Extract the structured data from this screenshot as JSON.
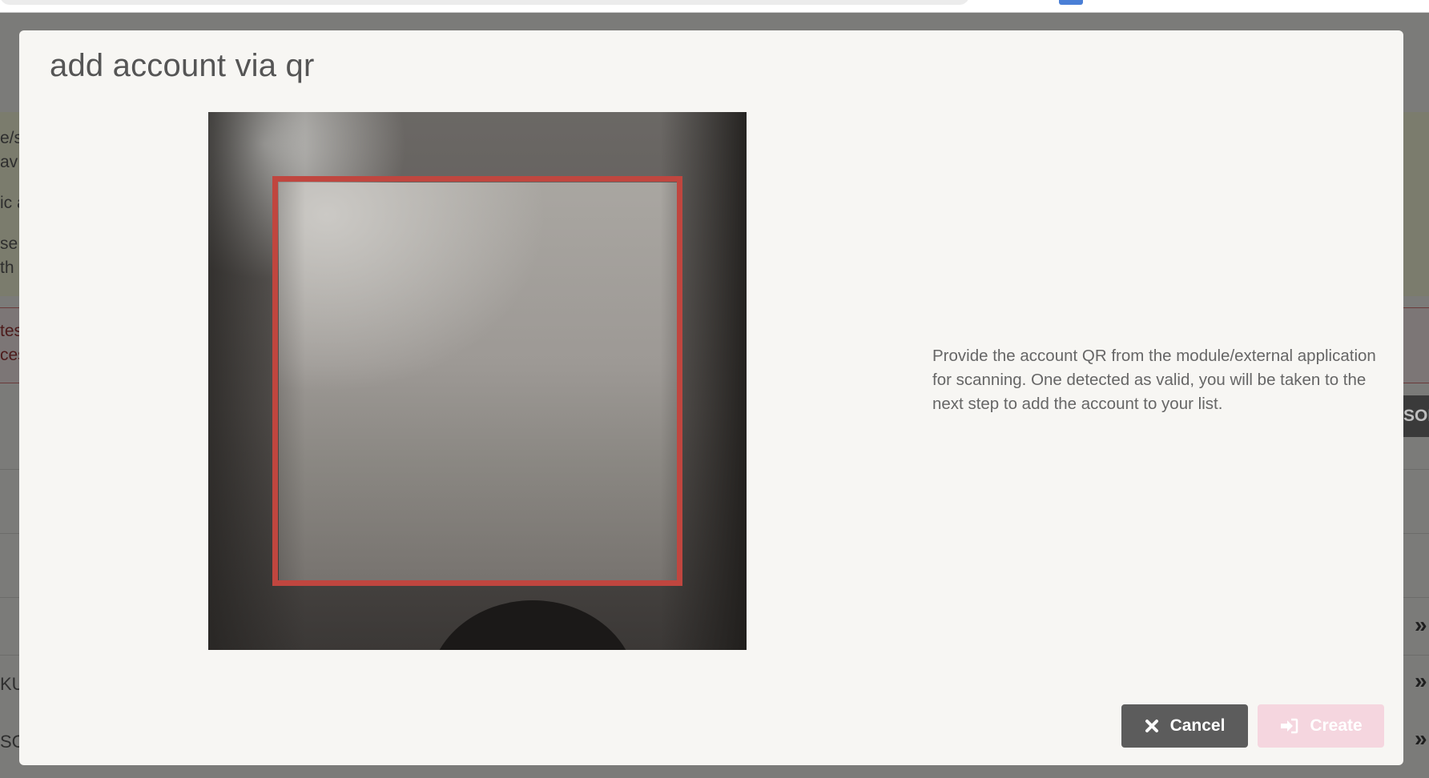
{
  "background": {
    "fragments": [
      {
        "text": "e/s",
        "kind": "plain"
      },
      {
        "text": "av",
        "kind": "plain"
      },
      {
        "text": "ic a",
        "kind": "plain"
      },
      {
        "text": "se",
        "kind": "plain"
      },
      {
        "text": "th",
        "kind": "plain"
      },
      {
        "text": "tes",
        "kind": "red"
      },
      {
        "text": "ces",
        "kind": "red"
      },
      {
        "text": "KU",
        "kind": "plain"
      },
      {
        "text": "SC",
        "kind": "plain"
      }
    ],
    "right_button_label": "SON",
    "chevron": "»"
  },
  "modal": {
    "title": "add account via qr",
    "instructions": "Provide the account QR from the module/external application for scanning. One detected as valid, you will be taken to the next step to add the account to your list.",
    "scan_frame_color": "#c0463f",
    "cancel_label": "Cancel",
    "create_label": "Create",
    "create_disabled": true
  }
}
